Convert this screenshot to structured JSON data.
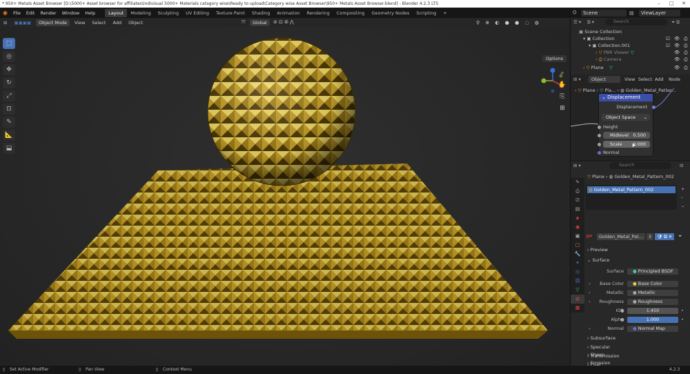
{
  "title": "* 950+ Metals Asset Browser [D:\\5000+ Asset browser for affiliates\\Indivisual 5000+ Materials catagory wise\\Ready to upload\\Category wise Asset Browser\\950+ Metals Asset Browser.blend] - Blender 4.2.3 LTS",
  "menu": [
    "File",
    "Edit",
    "Render",
    "Window",
    "Help"
  ],
  "workspaces": [
    "Layout",
    "Modeling",
    "Sculpting",
    "UV Editing",
    "Texture Paint",
    "Shading",
    "Animation",
    "Rendering",
    "Compositing",
    "Geometry Nodes",
    "Scripting",
    "+"
  ],
  "scene": "Scene",
  "view_layer": "ViewLayer",
  "viewport_header": {
    "mode": "Object Mode",
    "menus": [
      "View",
      "Select",
      "Add",
      "Object"
    ],
    "transform": "Global"
  },
  "viewport": {
    "options": "Options"
  },
  "outliner": {
    "search_placeholder": "Search",
    "items": [
      {
        "label": "Scene Collection"
      },
      {
        "label": "Collection"
      },
      {
        "label": "Collection.001"
      },
      {
        "label": "PBR Viewer"
      },
      {
        "label": "Camera"
      },
      {
        "label": "Plane"
      }
    ]
  },
  "node_editor": {
    "object_dropdown": "Object",
    "menus": [
      "View",
      "Select",
      "Add",
      "Node"
    ],
    "breadcrumb": [
      "Plane",
      "Pla...",
      "Golden_Metal_Patter..."
    ],
    "node": {
      "title": "Displacement",
      "output": "Displacement",
      "space": "Object Space",
      "inputs": [
        {
          "label": "Height"
        },
        {
          "label": "Midlevel",
          "value": "0.500"
        },
        {
          "label": "Scale",
          "value": "0.000"
        },
        {
          "label": "Normal"
        }
      ]
    }
  },
  "properties": {
    "search_placeholder": "Search",
    "breadcrumb": [
      "Plane",
      "Golden_Metal_Pattern_002"
    ],
    "slot": "Golden_Metal_Pattern_002",
    "material_name": "Golden_Metal_Pat...",
    "users": "3",
    "sections": {
      "preview": "Preview",
      "surface": "Surface"
    },
    "surface": {
      "label": "Surface",
      "value": "Principled BSDF"
    },
    "rows": [
      {
        "label": "Base Color",
        "value": "Base Color"
      },
      {
        "label": "Metallic",
        "value": "Metallic"
      },
      {
        "label": "Roughness",
        "value": "Roughness"
      },
      {
        "label": "IOR",
        "value": "1.450"
      },
      {
        "label": "Alpha",
        "value": "1.000"
      },
      {
        "label": "Normal",
        "value": "Normal Map"
      }
    ],
    "subsections": [
      "Subsurface",
      "Specular",
      "Transmission",
      "Coat",
      "Sheen",
      "Emission"
    ]
  },
  "status": {
    "left": "Set Active Modifier",
    "middle": "Pan View",
    "right": "Context Menu",
    "version": "4.2.3"
  },
  "colors": {
    "accent": "#4772b3",
    "gold": "#c9a227",
    "node_header": "#3b4fa8"
  }
}
